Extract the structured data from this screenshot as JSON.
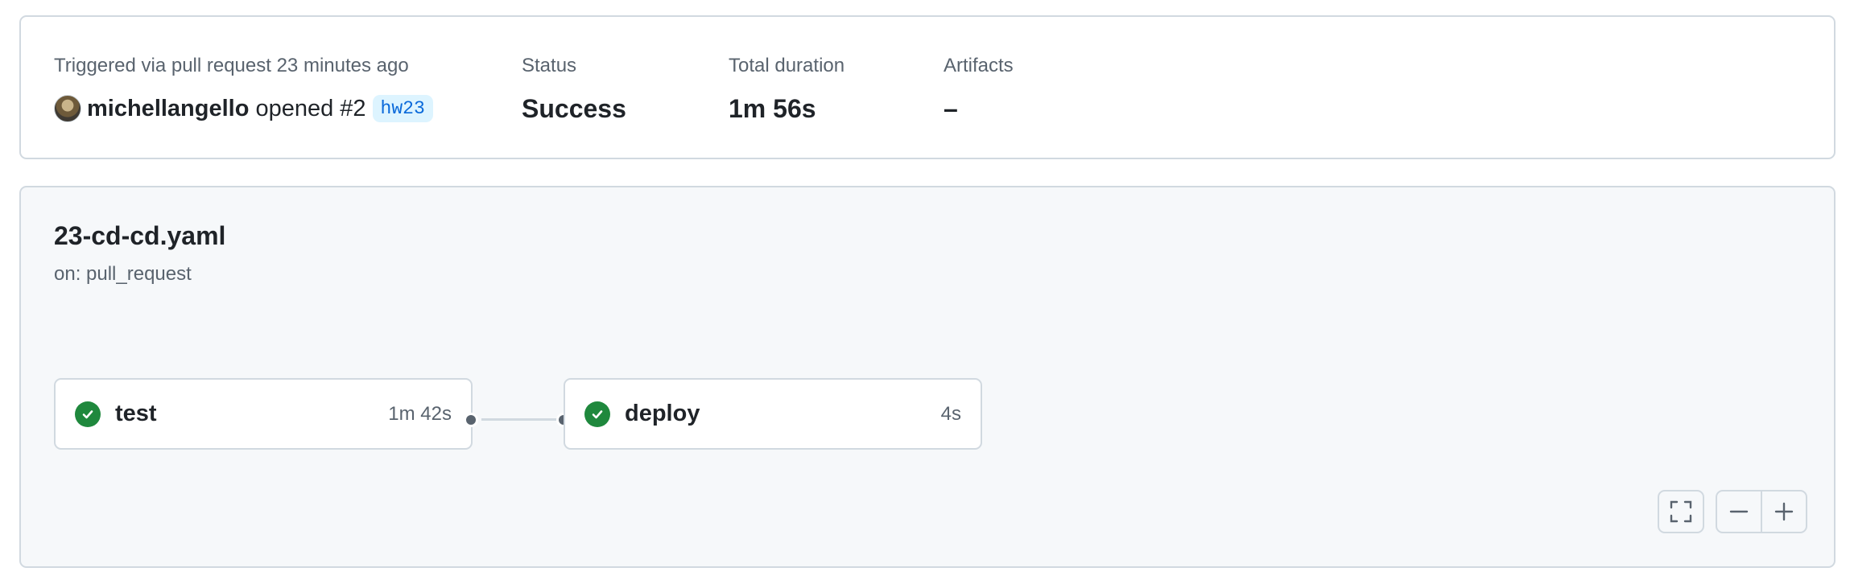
{
  "summary": {
    "trigger_label": "Triggered via pull request 23 minutes ago",
    "actor": "michellangello",
    "action": "opened #2",
    "branch": "hw23",
    "status_label": "Status",
    "status_value": "Success",
    "duration_label": "Total duration",
    "duration_value": "1m 56s",
    "artifacts_label": "Artifacts",
    "artifacts_value": "–"
  },
  "workflow": {
    "file": "23-cd-cd.yaml",
    "trigger": "on: pull_request",
    "jobs": [
      {
        "name": "test",
        "duration": "1m 42s",
        "status": "success"
      },
      {
        "name": "deploy",
        "duration": "4s",
        "status": "success"
      }
    ]
  },
  "controls": {
    "fullscreen_icon": "fullscreen-icon",
    "zoom_out_icon": "minus-icon",
    "zoom_in_icon": "plus-icon"
  },
  "colors": {
    "success": "#1f883d",
    "branch_text": "#0969da",
    "branch_bg": "#ddf4ff",
    "panel_bg": "#f6f8fa",
    "border": "#d1d9e0"
  }
}
